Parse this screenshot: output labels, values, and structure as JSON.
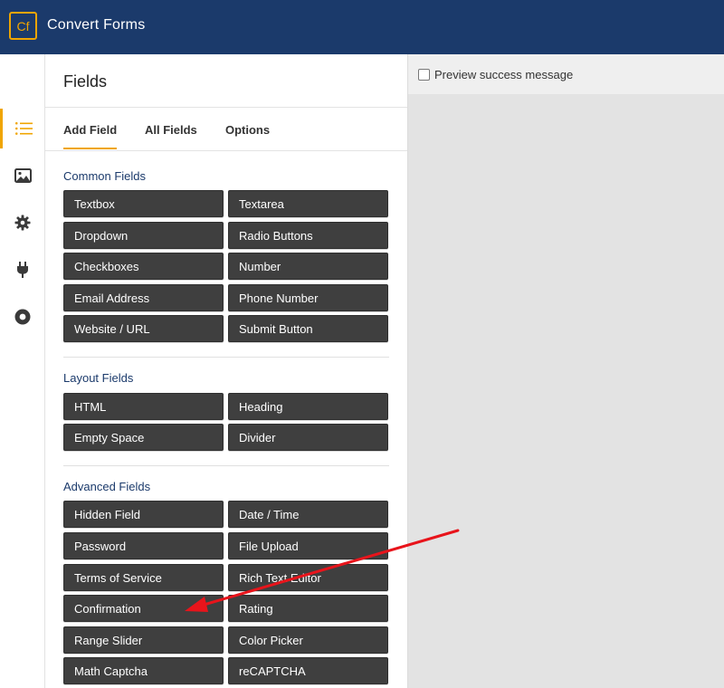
{
  "app": {
    "logo_text": "Cf",
    "title": "Convert Forms",
    "brand_color": "#1b3a6b",
    "accent_color": "#f0a500"
  },
  "iconbar": {
    "items": [
      {
        "icon": "list-icon",
        "active": true
      },
      {
        "icon": "image-icon",
        "active": false
      },
      {
        "icon": "gear-icon",
        "active": false
      },
      {
        "icon": "plug-icon",
        "active": false
      },
      {
        "icon": "record-icon",
        "active": false
      }
    ]
  },
  "panel": {
    "title": "Fields",
    "tabs": [
      {
        "label": "Add Field",
        "active": true
      },
      {
        "label": "All Fields",
        "active": false
      },
      {
        "label": "Options",
        "active": false
      }
    ],
    "sections": [
      {
        "title": "Common Fields",
        "buttons": [
          "Textbox",
          "Textarea",
          "Dropdown",
          "Radio Buttons",
          "Checkboxes",
          "Number",
          "Email Address",
          "Phone Number",
          "Website / URL",
          "Submit Button"
        ]
      },
      {
        "title": "Layout Fields",
        "buttons": [
          "HTML",
          "Heading",
          "Empty Space",
          "Divider"
        ]
      },
      {
        "title": "Advanced Fields",
        "buttons": [
          "Hidden Field",
          "Date / Time",
          "Password",
          "File Upload",
          "Terms of Service",
          "Rich Text Editor",
          "Confirmation",
          "Rating",
          "Range Slider",
          "Color Picker",
          "Math Captcha",
          "reCAPTCHA"
        ]
      }
    ]
  },
  "preview": {
    "checkbox_label": "Preview success message",
    "checked": false
  },
  "annotation": {
    "arrow_color": "#e8141b",
    "points_to": "Confirmation"
  }
}
